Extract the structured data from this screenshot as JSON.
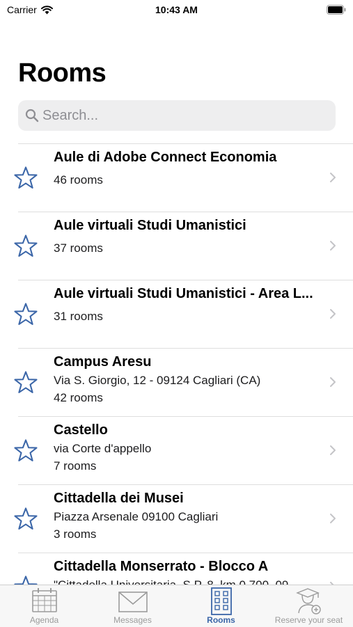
{
  "status": {
    "carrier": "Carrier",
    "time": "10:43 AM"
  },
  "title": "Rooms",
  "search": {
    "placeholder": "Search...",
    "value": ""
  },
  "rows": [
    {
      "name": "Aule di Adobe Connect Economia",
      "address": "",
      "count": "46 rooms"
    },
    {
      "name": "Aule virtuali Studi Umanistici",
      "address": "",
      "count": "37 rooms"
    },
    {
      "name": "Aule virtuali Studi Umanistici - Area L...",
      "address": "",
      "count": "31 rooms"
    },
    {
      "name": "Campus Aresu",
      "address": "Via S. Giorgio, 12 - 09124 Cagliari (CA)",
      "count": "42 rooms"
    },
    {
      "name": "Castello",
      "address": "via Corte d'appello",
      "count": "7 rooms"
    },
    {
      "name": "Cittadella dei Musei",
      "address": "Piazza Arsenale 09100 Cagliari",
      "count": "3 rooms"
    },
    {
      "name": "Cittadella Monserrato - Blocco A",
      "address": "\"Cittadella Universitaria, S.P. 8, km 0.700, 09",
      "count": ""
    }
  ],
  "tabs": [
    {
      "label": "Agenda",
      "icon": "calendar-icon",
      "active": false
    },
    {
      "label": "Messages",
      "icon": "envelope-icon",
      "active": false
    },
    {
      "label": "Rooms",
      "icon": "building-icon",
      "active": true
    },
    {
      "label": "Reserve your seat",
      "icon": "student-add-icon",
      "active": false
    }
  ],
  "colors": {
    "accent": "#3b66a8",
    "star": "#3b66a8",
    "inactive": "#9b9b9b",
    "search_bg": "#eeeeef"
  }
}
